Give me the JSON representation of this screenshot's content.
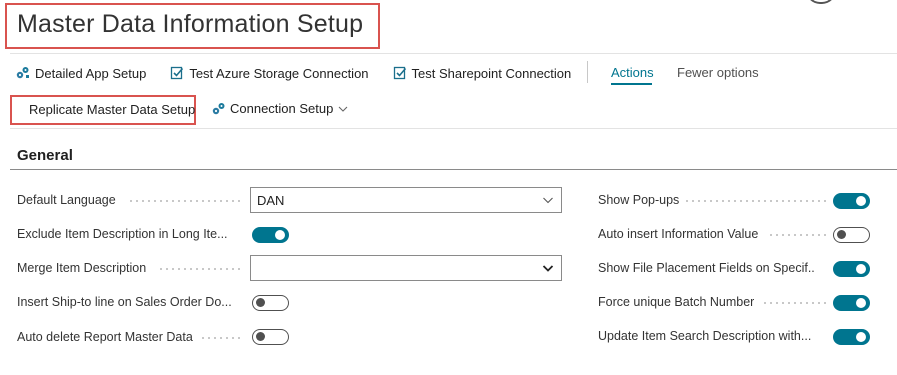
{
  "page": {
    "title": "Master Data Information Setup"
  },
  "action_bar": {
    "items": [
      {
        "label": "Detailed App Setup",
        "icon": "gear-cluster-icon"
      },
      {
        "label": "Test Azure Storage Connection",
        "icon": "check-document-icon"
      },
      {
        "label": "Test Sharepoint Connection",
        "icon": "check-document-icon"
      }
    ],
    "tab_actions": "Actions",
    "tab_fewer": "Fewer options"
  },
  "second_bar": {
    "replicate": "Replicate Master Data Setup",
    "connection_setup": "Connection Setup"
  },
  "general": {
    "title": "General",
    "left": [
      {
        "label": "Default Language",
        "type": "select",
        "value": "DAN"
      },
      {
        "label": "Exclude Item Description in Long Ite...",
        "type": "toggle",
        "value": true
      },
      {
        "label": "Merge Item Description",
        "type": "select",
        "value": ""
      },
      {
        "label": "Insert Ship-to line on Sales Order Do...",
        "type": "toggle",
        "value": false
      },
      {
        "label": "Auto delete Report Master Data",
        "type": "toggle",
        "value": false
      }
    ],
    "right": [
      {
        "label": "Show Pop-ups",
        "type": "toggle",
        "value": true
      },
      {
        "label": "Auto insert Information Value",
        "type": "toggle",
        "value": false
      },
      {
        "label": "Show File Placement Fields on Specif...",
        "type": "toggle",
        "value": true
      },
      {
        "label": "Force unique Batch Number",
        "type": "toggle",
        "value": true
      },
      {
        "label": "Update Item Search Description with...",
        "type": "toggle",
        "value": true
      }
    ]
  },
  "colors": {
    "accent": "#00758f",
    "highlight_border": "#d9534f"
  }
}
